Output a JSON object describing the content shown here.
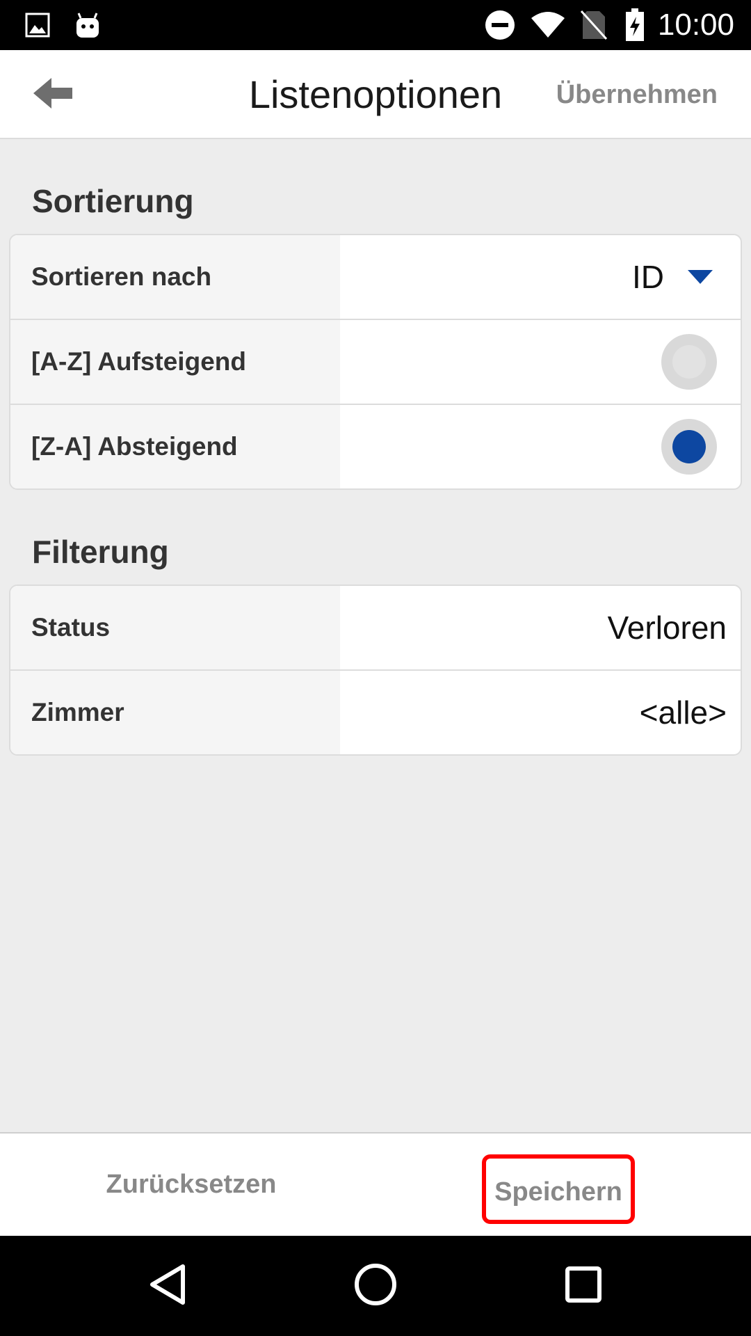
{
  "status_bar": {
    "time": "10:00",
    "icons": [
      "gallery-icon",
      "android-icon",
      "do-not-disturb-icon",
      "wifi-icon",
      "no-sim-icon",
      "battery-charging-icon"
    ]
  },
  "app_bar": {
    "back_icon": "arrow-left-icon",
    "title": "Listenoptionen",
    "apply_label": "Übernehmen"
  },
  "sort": {
    "title": "Sortierung",
    "sort_by_label": "Sortieren nach",
    "sort_by_value": "ID",
    "asc_label": "[A-Z] Aufsteigend",
    "asc_selected": false,
    "desc_label": "[Z-A] Absteigend",
    "desc_selected": true
  },
  "filter": {
    "title": "Filterung",
    "status_label": "Status",
    "status_value": "Verloren",
    "room_label": "Zimmer",
    "room_value": "<alle>"
  },
  "bottom_bar": {
    "reset_label": "Zurücksetzen",
    "save_label": "Speichern"
  },
  "colors": {
    "accent": "#0d47a1",
    "highlight_border": "#ff0000",
    "muted_text": "#888888"
  },
  "nav_bar": {
    "icons": [
      "back-triangle-icon",
      "home-circle-icon",
      "recents-square-icon"
    ]
  }
}
